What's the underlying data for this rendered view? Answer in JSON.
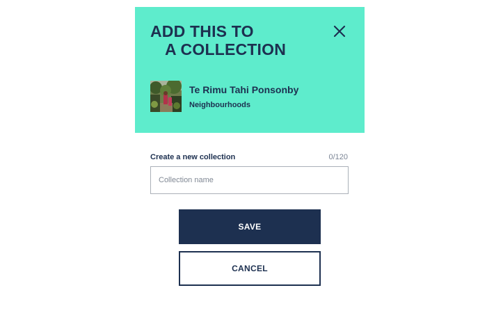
{
  "dialog": {
    "title_line1": "ADD THIS TO",
    "title_line2": "A COLLECTION",
    "close_icon": "close-icon"
  },
  "item": {
    "name": "Te Rimu Tahi Ponsonby",
    "category": "Neighbourhoods",
    "thumbnail": "garden-thumbnail"
  },
  "form": {
    "label": "Create a new collection",
    "char_count": "0/120",
    "value": "",
    "placeholder": "Collection name"
  },
  "buttons": {
    "save_label": "SAVE",
    "cancel_label": "CANCEL"
  },
  "colors": {
    "header_bg": "#5eeccc",
    "navy": "#1d3050",
    "background": "#ffffff"
  }
}
